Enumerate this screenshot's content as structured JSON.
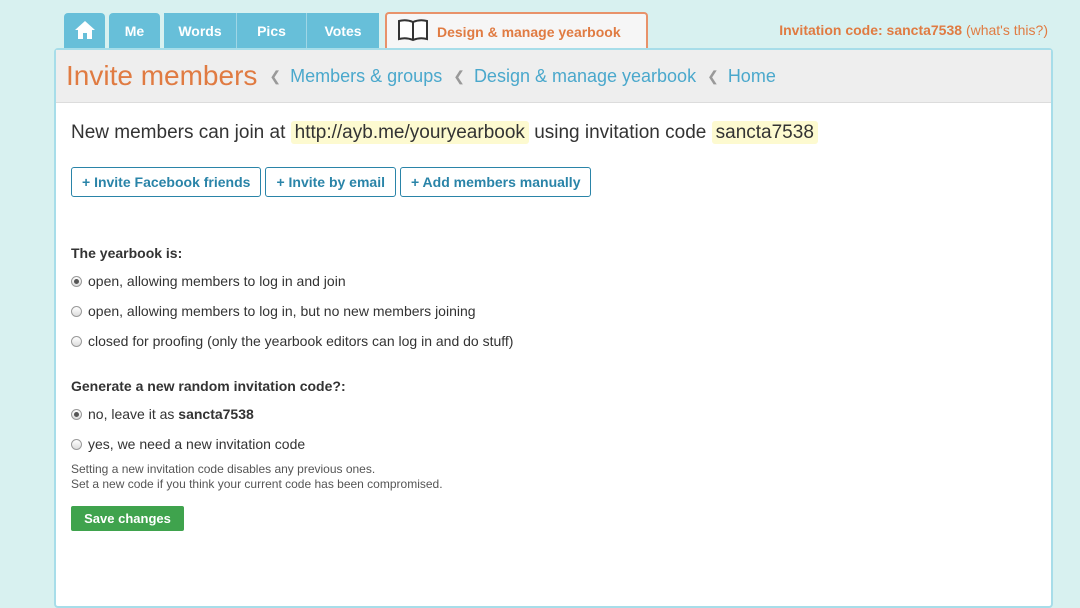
{
  "nav": {
    "tabs": [
      "Me",
      "Words",
      "Pics",
      "Votes"
    ],
    "active_tab": "Design & manage yearbook"
  },
  "header": {
    "invite_label": "Invitation code: sancta7538",
    "whats_this": "what's this?"
  },
  "page": {
    "title": "Invite members",
    "breadcrumbs": [
      "Members & groups",
      "Design & manage yearbook",
      "Home"
    ]
  },
  "intro": {
    "prefix": "New members can join at",
    "url": "http://ayb.me/youryearbook",
    "middle": "using invitation code",
    "code": "sancta7538"
  },
  "buttons": {
    "facebook": "+ Invite Facebook friends",
    "email": "+ Invite by email",
    "manual": "+ Add members manually",
    "save": "Save changes"
  },
  "yearbook_status": {
    "label": "The yearbook is:",
    "options": [
      "open, allowing members to log in and join",
      "open, allowing members to log in, but no new members joining",
      "closed for proofing (only the yearbook editors can log in and do stuff)"
    ],
    "selected": 0
  },
  "new_code": {
    "label": "Generate a new random invitation code?:",
    "option_no_prefix": "no, leave it as",
    "option_no_code": "sancta7538",
    "option_yes": "yes, we need a new invitation code",
    "selected": 0,
    "help_1": "Setting a new invitation code disables any previous ones.",
    "help_2": "Set a new code if you think your current code has been compromised."
  },
  "icons": {
    "home": "home-icon",
    "book": "book-icon"
  },
  "colors": {
    "accent": "#e07b42",
    "tab": "#67bfd9",
    "link": "#4aa8cc",
    "save": "#3fa34d"
  }
}
